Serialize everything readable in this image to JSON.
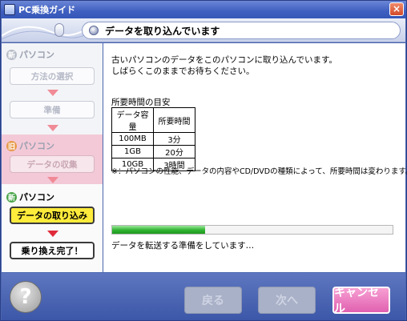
{
  "window": {
    "title": "PC乗換ガイド",
    "close_label": "×"
  },
  "header": {
    "title": "データを取り込んでいます"
  },
  "sidebar": {
    "sections": [
      {
        "badge": "新",
        "label": "パソコン"
      },
      {
        "badge": "旧",
        "label": "パソコン"
      },
      {
        "badge": "新",
        "label": "パソコン"
      }
    ],
    "steps": {
      "method": "方法の選択",
      "prepare": "準備",
      "collect": "データの収集",
      "import": "データの取り込み",
      "complete": "乗り換え完了！"
    }
  },
  "content": {
    "message_line1": "古いパソコンのデータをこのパソコンに取り込んでいます。",
    "message_line2": "しばらくこのままでお待ちください。",
    "table_title": "所要時間の目安",
    "table_headers": [
      "データ容量",
      "所要時間"
    ],
    "table_rows": [
      [
        "100MB",
        "3分"
      ],
      [
        "1GB",
        "20分"
      ],
      [
        "10GB",
        "3時間"
      ]
    ],
    "note": "※：パソコンの性能、データの内容やCD/DVDの種類によって、所要時間は変わります。",
    "progress_fraction": 0.33,
    "status": "データを転送する準備をしています…"
  },
  "footer": {
    "help_label": "?",
    "back_label": "戻る",
    "next_label": "次へ",
    "cancel_label": "キャンセル"
  }
}
